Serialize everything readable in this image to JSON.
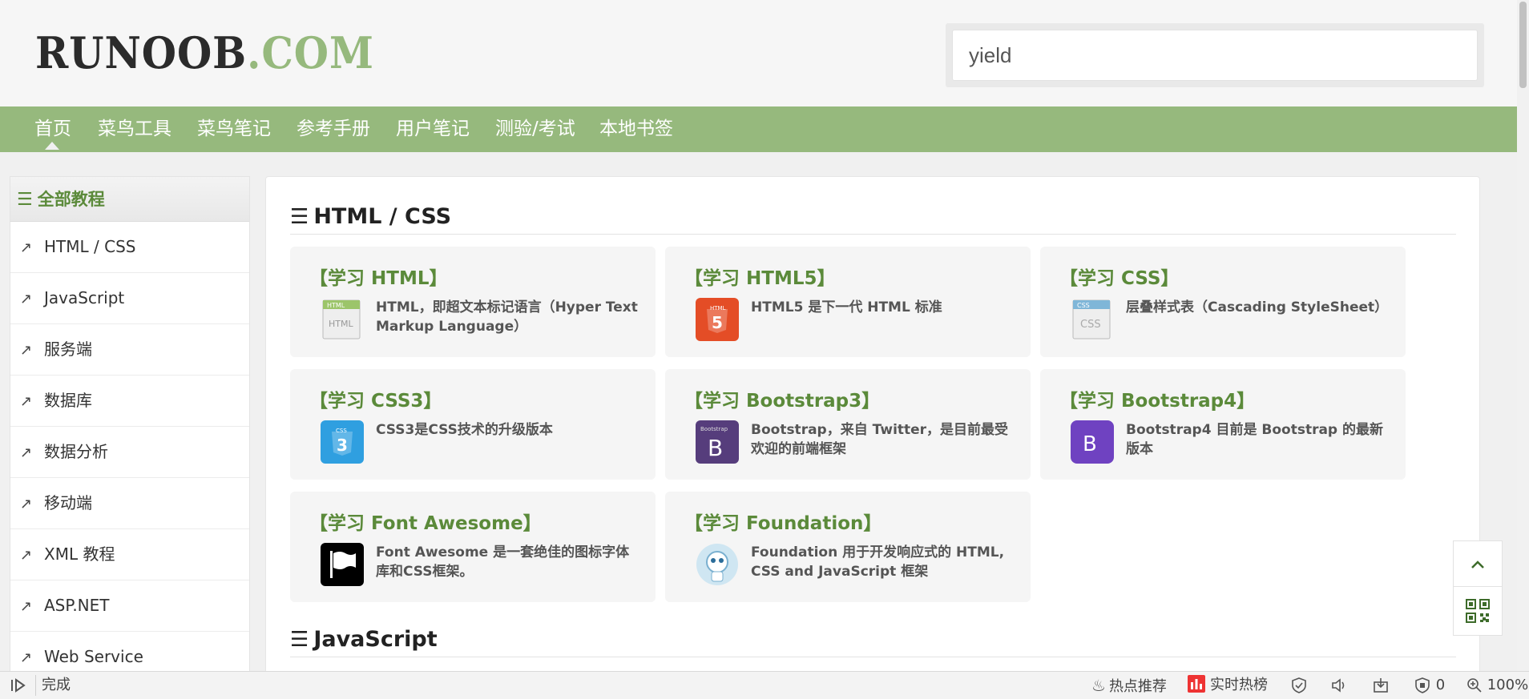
{
  "header": {
    "logo_main": "RUNOOB",
    "logo_dot": ".",
    "logo_tld": "COM",
    "search_value": "yield"
  },
  "nav": {
    "items": [
      "首页",
      "菜鸟工具",
      "菜鸟笔记",
      "参考手册",
      "用户笔记",
      "测验/考试",
      "本地书签"
    ]
  },
  "sidebar": {
    "heading": "全部教程",
    "items": [
      "HTML / CSS",
      "JavaScript",
      "服务端",
      "数据库",
      "数据分析",
      "移动端",
      "XML 教程",
      "ASP.NET",
      "Web Service"
    ]
  },
  "sections": [
    {
      "title": "HTML / CSS",
      "cards": [
        {
          "title": "【学习 HTML】",
          "desc": "HTML，即超文本标记语言（Hyper Text Markup Language）",
          "icon": "html-icon"
        },
        {
          "title": "【学习 HTML5】",
          "desc": "HTML5 是下一代 HTML 标准",
          "icon": "html5-icon"
        },
        {
          "title": "【学习 CSS】",
          "desc": "层叠样式表（Cascading StyleSheet）",
          "icon": "css-icon"
        },
        {
          "title": "【学习 CSS3】",
          "desc": "CSS3是CSS技术的升级版本",
          "icon": "css3-icon"
        },
        {
          "title": "【学习 Bootstrap3】",
          "desc": "Bootstrap，来自 Twitter，是目前最受欢迎的前端框架",
          "icon": "bootstrap3-icon"
        },
        {
          "title": "【学习 Bootstrap4】",
          "desc": "Bootstrap4 目前是 Bootstrap 的最新版本",
          "icon": "bootstrap4-icon"
        },
        {
          "title": "【学习 Font Awesome】",
          "desc": "Font Awesome 是一套绝佳的图标字体库和CSS框架。",
          "icon": "font-awesome-icon"
        },
        {
          "title": "【学习 Foundation】",
          "desc": "Foundation 用于开发响应式的 HTML, CSS and JavaScript 框架",
          "icon": "foundation-icon"
        }
      ]
    },
    {
      "title": "JavaScript"
    }
  ],
  "icon_labels": {
    "html": "HTML",
    "html_sub": "HTML",
    "html5": "HTML",
    "html5_digit": "5",
    "css": "CSS",
    "css_sub": "CSS",
    "css3": "CSS",
    "css3_digit": "3",
    "bootstrap3": "Bootstrap",
    "bootstrap_letter": "B",
    "bootstrap4_letter": "B"
  },
  "statusbar": {
    "status": "完成",
    "hot_recommend": "热点推荐",
    "realtime_hot": "实时热榜",
    "blocked_count": "0",
    "zoom": "100%"
  },
  "colors": {
    "nav_bg": "#96b97d",
    "brand_green": "#5b8a3a",
    "logo_dark": "#2b2b2b"
  }
}
